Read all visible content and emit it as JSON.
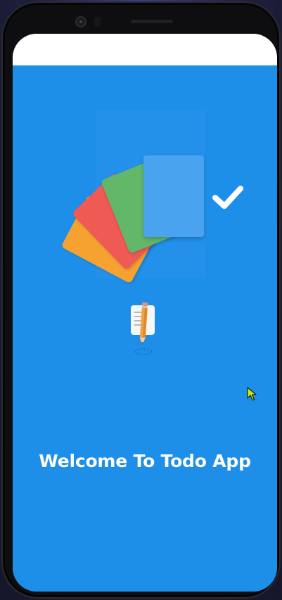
{
  "app": {
    "welcome_text": "Welcome To Todo App"
  },
  "icons": {
    "logo": "todo-cards-check-icon",
    "illustration": "notepad-pencil-icon",
    "cursor": "mouse-pointer-icon"
  },
  "colors": {
    "background": "#1e8fe9",
    "status_bar": "#ffffff",
    "card_orange": "#f5a230",
    "card_red": "#ef5a55",
    "card_green": "#62b868",
    "card_blue": "#4aa3ee",
    "text": "#ffffff",
    "cursor": "#c6f200"
  }
}
